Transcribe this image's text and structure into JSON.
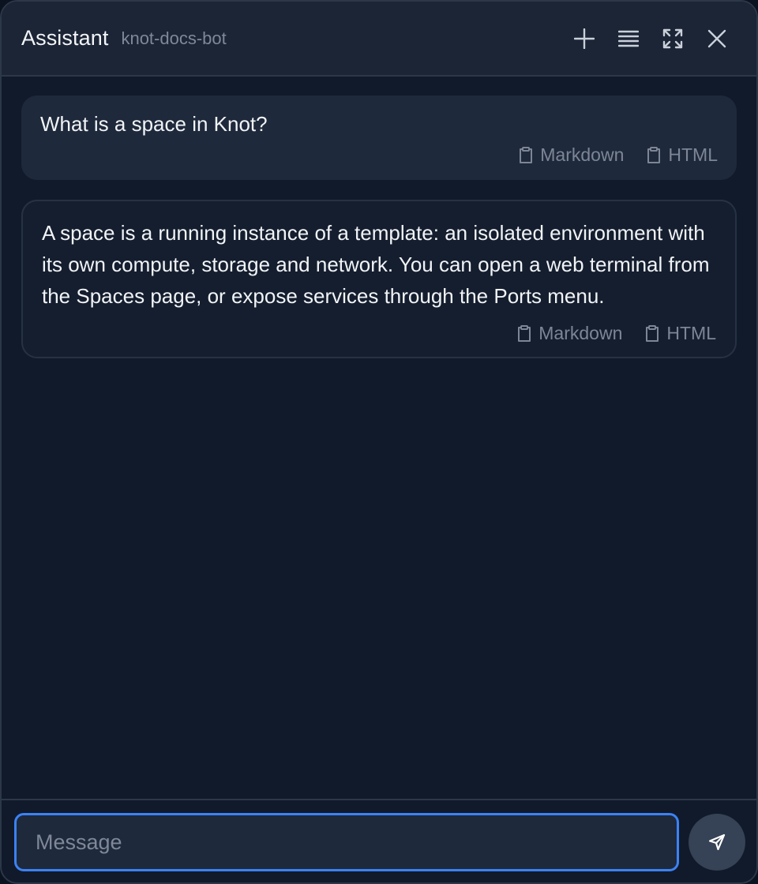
{
  "header": {
    "title": "Assistant",
    "subtitle": "knot-docs-bot",
    "actions": [
      {
        "name": "new-chat-button",
        "icon": "plus-icon"
      },
      {
        "name": "history-button",
        "icon": "list-icon"
      },
      {
        "name": "expand-button",
        "icon": "expand-icon"
      },
      {
        "name": "close-button",
        "icon": "close-icon"
      }
    ]
  },
  "messages": [
    {
      "role": "user",
      "text": "What is a space in Knot?",
      "copy_markdown": "Markdown",
      "copy_html": "HTML"
    },
    {
      "role": "assistant",
      "text": "A space is a running instance of a template: an isolated environment with its own compute, storage and network. You can open a web terminal from the Spaces page, or expose services through the Ports menu.",
      "copy_markdown": "Markdown",
      "copy_html": "HTML"
    }
  ],
  "composer": {
    "placeholder": "Message",
    "value": ""
  },
  "colors": {
    "background": "#111a2a",
    "header": "#1b2535",
    "accent": "#3b82f6",
    "send_button": "#364255"
  }
}
